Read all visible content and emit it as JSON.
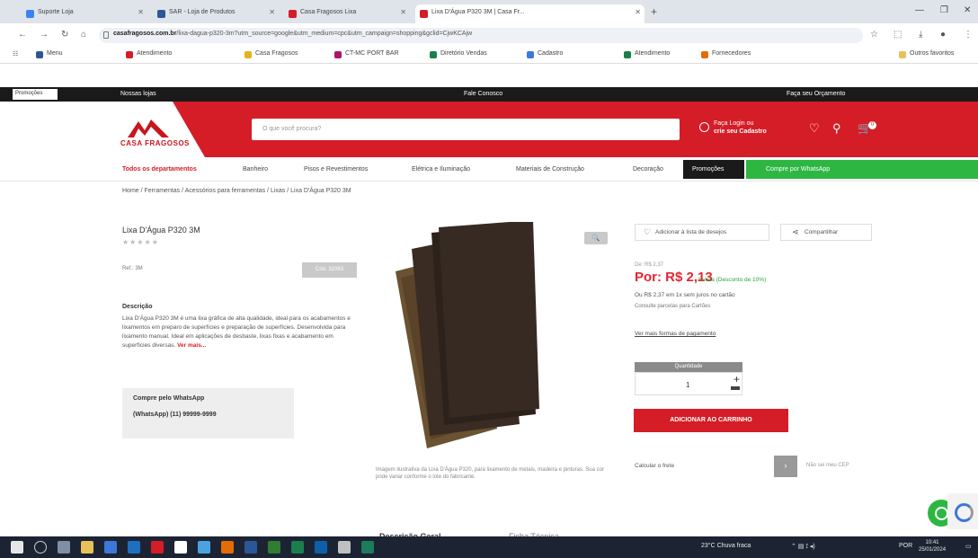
{
  "browser": {
    "tabs": [
      {
        "label": "Suporte Loja",
        "fav": "#3b82f6"
      },
      {
        "label": "SAR - Loja de Produtos",
        "fav": "#2b5797"
      },
      {
        "label": "Casa Fragosos Lixa",
        "fav": "#d51d27"
      },
      {
        "label": "Lixa D'Água P320 3M | Casa Fr...",
        "fav": "#d51d27"
      }
    ],
    "new_tab": "+",
    "url_host": "casafragosos.com.br",
    "url_path": "/lixa-dagua-p320-3m?utm_source=google&utm_medium=cpc&utm_campaign=shopping&gclid=CjwKCAjw",
    "bookmarks": [
      {
        "label": "Menu",
        "fav": "#2b5797"
      },
      {
        "label": "Atendimento",
        "fav": "#d51d27"
      },
      {
        "label": "Casa Fragosos",
        "fav": "#e6b31a"
      },
      {
        "label": "CT-MC PORT BAR",
        "fav": "#b3126b"
      },
      {
        "label": "Diretório Vendas",
        "fav": "#1a7f4b"
      },
      {
        "label": "Cadastro",
        "fav": "#3c78d8"
      },
      {
        "label": "Atendimento",
        "fav": "#1a7f4b"
      },
      {
        "label": "Fornecedores",
        "fav": "#e36c09"
      }
    ],
    "bookmarks_right": "Outros favoritos"
  },
  "site": {
    "topstrip": {
      "promo": "Promoções",
      "left": "Nossas lojas",
      "center": "Fale Conosco",
      "right": "Faça seu Orçamento"
    },
    "logo_name": "CASA FRAGOSOS",
    "search_placeholder": "O que você procura?",
    "account_line1": "Faça Login ou",
    "account_line2": "crie seu Cadastro",
    "cart_count": "0",
    "categories": [
      "Todos os departamentos",
      "Banheiro",
      "Pisos e Revestimentos",
      "Elétrica e Iluminação",
      "Materiais de Construção",
      "Decoração"
    ],
    "promocoes": "Promoções",
    "whatsapp_nav": "Compre por WhatsApp",
    "breadcrumb": "Home / Ferramentas / Acessórios para ferramentas / Lixas / Lixa D'Água P320 3M"
  },
  "product": {
    "title": "Lixa D'Água P320 3M",
    "stars": "★★★★★",
    "sku": "Ref.: 3M",
    "tag": "Cód. 31063",
    "desc_heading": "Descrição",
    "description": "Lixa D'Água P320 3M é uma lixa gráfica de alta qualidade, ideal para os acabamentos e lixamentos em preparo de superfícies e preparação de superfícies. Desenvolvida para lixamento manual. Ideal em aplicações de desbaste, lixas fixas e acabamento em superfícies diversas.",
    "desc_more": "Ver mais...",
    "wa_line1": "Compre pelo WhatsApp",
    "wa_line2": "(WhatsApp) (11) 99999-9999",
    "zoom": "🔍",
    "caption": "Imagem ilustrativa da Lixa D'Água P320, para lixamento de metais, madeira e pinturas. Sua cor pode variar conforme o lote do fabricante.",
    "fav_label": "Adicionar à lista de desejos",
    "share_label": "Compartilhar",
    "old_price": "De: R$ 2,37",
    "price": "Por: R$ 2,13",
    "price_extra": "à vista (Desconto de 10%)",
    "installments": "Ou R$ 2,37 em 1x sem juros no cartão",
    "installments2": "Consulte parcelas para Cartões",
    "pay_options": "Ver mais formas de pagamento",
    "qty_label": "Quantidade",
    "qty": "1",
    "add_to_cart": "ADICIONAR AO CARRINHO",
    "frete": "Calcular o frete",
    "cep_btn": "›",
    "cep_help": "Não sei meu CEP",
    "tab_desc": "Descrição Geral",
    "tab_spec": "Ficha Técnica"
  },
  "taskbar": {
    "weather": "23°C Chuva fraca",
    "time": "10:41",
    "date": "25/01/2024",
    "lang": "POR"
  },
  "colors": {
    "brand_red": "#d51d27",
    "price_red": "#e3262f",
    "whatsapp_green": "#2db742"
  }
}
